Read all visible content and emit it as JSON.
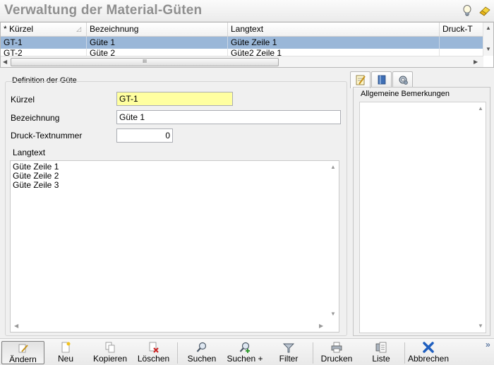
{
  "window": {
    "title": "Verwaltung der Material-Güten"
  },
  "grid": {
    "columns": [
      "Kürzel",
      "Bezeichnung",
      "Langtext",
      "Druck-T"
    ],
    "sort_marker": "*",
    "rows": [
      {
        "kuerzel": "GT-1",
        "bezeichnung": "Güte 1",
        "langtext": "Güte Zeile 1",
        "druck": "",
        "selected": true
      },
      {
        "kuerzel": "GT-2",
        "bezeichnung": "Güte 2",
        "langtext": "Güte2 Zeile 1",
        "druck": "",
        "selected": false
      }
    ],
    "hscroll_thumb_glyph": "III"
  },
  "form": {
    "group_title": "Definition der Güte",
    "kuerzel_label": "Kürzel",
    "kuerzel_value": "GT-1",
    "bezeichnung_label": "Bezeichnung",
    "bezeichnung_value": "Güte 1",
    "druck_label": "Druck-Textnummer",
    "druck_value": "0",
    "langtext_label": "Langtext",
    "langtext_lines": [
      "Güte Zeile 1",
      "Güte Zeile 2",
      "Güte Zeile 3"
    ]
  },
  "side": {
    "tabs": [
      "notes-icon",
      "book-icon",
      "settings-icon"
    ],
    "panel_title": "Allgemeine Bemerkungen"
  },
  "toolbar": {
    "buttons": [
      {
        "label": "Ändern",
        "icon": "edit-icon",
        "pressed": true
      },
      {
        "label": "Neu",
        "icon": "new-document-icon",
        "pressed": false
      },
      {
        "label": "Kopieren",
        "icon": "copy-icon",
        "pressed": false
      },
      {
        "label": "Löschen",
        "icon": "delete-icon",
        "pressed": false
      },
      {
        "label": "Suchen",
        "icon": "search-icon",
        "pressed": false
      },
      {
        "label": "Suchen +",
        "icon": "search-plus-icon",
        "pressed": false
      },
      {
        "label": "Filter",
        "icon": "filter-icon",
        "pressed": false
      },
      {
        "label": "Drucken",
        "icon": "print-icon",
        "pressed": false
      },
      {
        "label": "Liste",
        "icon": "list-icon",
        "pressed": false
      },
      {
        "label": "Abbrechen",
        "icon": "cancel-icon",
        "pressed": false
      }
    ],
    "overflow": "»"
  },
  "colors": {
    "selection": "#9ab7d8",
    "key_field": "#ffffa0",
    "title_text": "#8f8f8f",
    "cancel_blue": "#1f5fbf",
    "delete_red": "#cc2222"
  }
}
